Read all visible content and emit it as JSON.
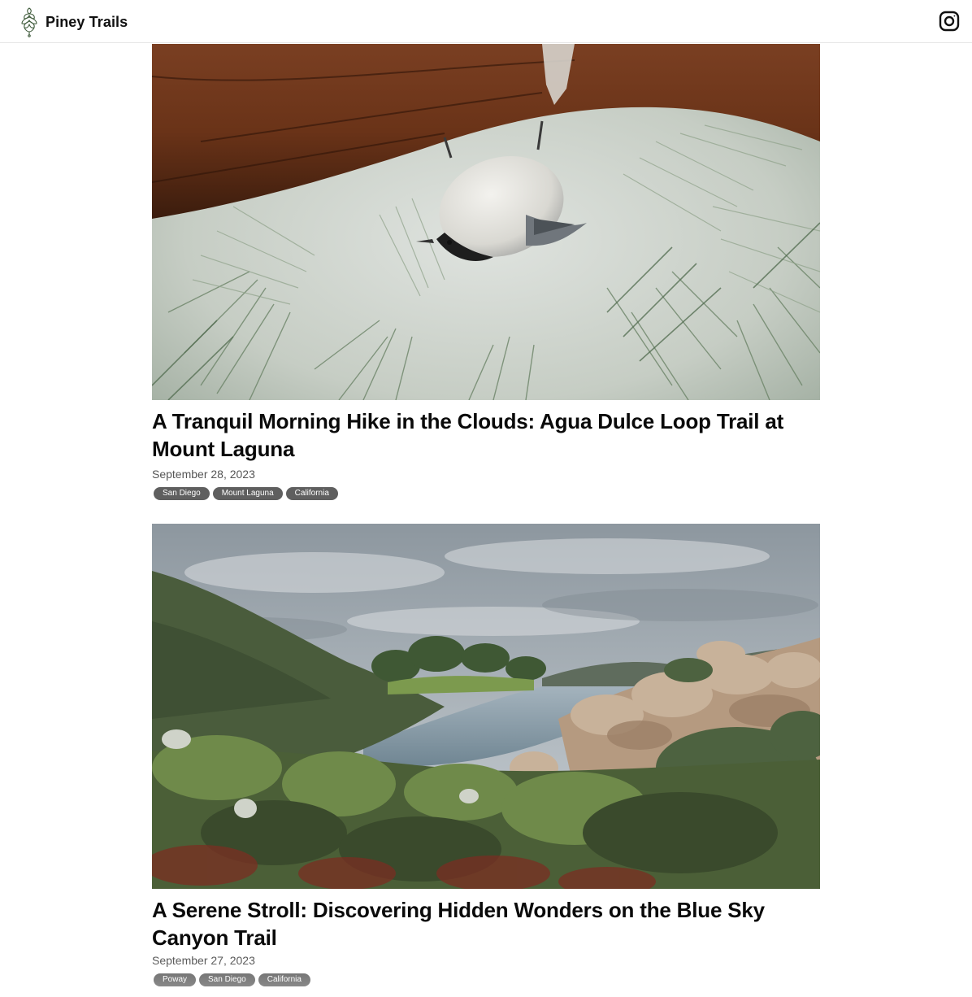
{
  "site": {
    "name": "Piney Trails",
    "logo_icon": "pinecone-icon",
    "social_icon": "instagram-icon"
  },
  "posts": [
    {
      "title": "A Tranquil Morning Hike in the Clouds: Agua Dulce Loop Trail at Mount Laguna",
      "date": "September 28, 2023",
      "tags": [
        "San Diego",
        "Mount Laguna",
        "California"
      ],
      "image_icon": "nuthatch-photo"
    },
    {
      "title": "A Serene Stroll: Discovering Hidden Wonders on the Blue Sky Canyon Trail",
      "date": "September 27, 2023",
      "tags": [
        "Poway",
        "San Diego",
        "California"
      ],
      "image_icon": "lake-canyon-photo"
    }
  ],
  "colors": {
    "tag_bg": "#5f5f5f",
    "tag_text": "#ffffff",
    "title": "#0a0a0a",
    "date": "#555555"
  }
}
